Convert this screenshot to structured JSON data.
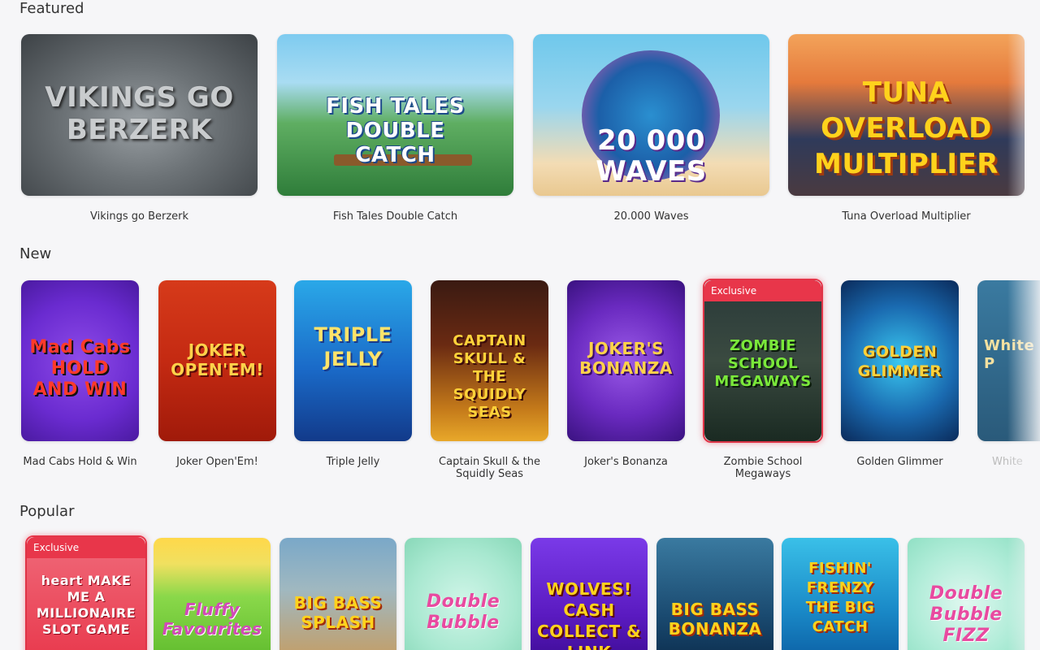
{
  "sections": {
    "featured": {
      "title": "Featured",
      "games": [
        {
          "name": "Vikings go Berzerk",
          "art": "VIKINGS GO BERZERK"
        },
        {
          "name": "Fish Tales Double Catch",
          "art": "FISH TALES DOUBLE CATCH"
        },
        {
          "name": "20.000 Waves",
          "art": "20 000 WAVES"
        },
        {
          "name": "Tuna Overload Multiplier",
          "art": "TUNA OVERLOAD MULTIPLIER"
        }
      ]
    },
    "new": {
      "title": "New",
      "games": [
        {
          "name": "Mad Cabs Hold & Win",
          "art": "Mad Cabs HOLD AND WIN"
        },
        {
          "name": "Joker Open'Em!",
          "art": "JOKER OPEN'EM!"
        },
        {
          "name": "Triple Jelly",
          "art": "TRIPLE JELLY"
        },
        {
          "name": "Captain Skull & the Squidly Seas",
          "art": "CAPTAIN SKULL & THE SQUIDLY SEAS"
        },
        {
          "name": "Joker's Bonanza",
          "art": "JOKER'S BONANZA"
        },
        {
          "name": "Zombie School Megaways",
          "art": "ZOMBIE SCHOOL MEGAWAYS",
          "badge": "Exclusive"
        },
        {
          "name": "Golden Glimmer",
          "art": "GOLDEN GLIMMER"
        },
        {
          "name": "White",
          "art": "White Tiger P"
        }
      ]
    },
    "popular": {
      "title": "Popular",
      "games": [
        {
          "art": "heart MAKE ME A MILLIONAIRE SLOT GAME",
          "badge": "Exclusive"
        },
        {
          "art": "Fluffy Favourites"
        },
        {
          "art": "BIG BASS SPLASH"
        },
        {
          "art": "Double Bubble"
        },
        {
          "art": "WOLVES! CASH COLLECT & LINK"
        },
        {
          "art": "BIG BASS BONANZA"
        },
        {
          "art": "FISHIN' FRENZY THE BIG CATCH"
        },
        {
          "art": "Double Bubble FIZZ"
        }
      ]
    }
  },
  "colors": {
    "exclusive": "#e8364a",
    "background": "#f6f6f8"
  }
}
